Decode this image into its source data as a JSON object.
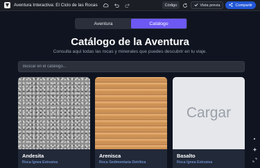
{
  "topbar": {
    "title": "Aventura Interactiva: El Ciclo de las Rocas",
    "code_label": "Código",
    "preview_label": "Vista previa",
    "share_label": "Compartir",
    "icons": [
      "app-logo",
      "cloud-icon",
      "undo-icon",
      "redo-icon",
      "refresh-icon",
      "check-icon",
      "share-icon"
    ]
  },
  "tabs": [
    {
      "label": "Aventura",
      "active": false
    },
    {
      "label": "Catálogo",
      "active": true
    }
  ],
  "main": {
    "title": "Catálogo de la Aventura",
    "subtitle": "Consulta aquí todas las rocas y minerales que puedes descubrir en tu viaje.",
    "search_placeholder": "Buscar en el catálogo..."
  },
  "cards": [
    {
      "name": "Andesita",
      "type": "Roca Ígnea Extrusiva"
    },
    {
      "name": "Arenisca",
      "type": "Roca Sedimentaria Detrítica"
    },
    {
      "name": "Basalto",
      "type": "Roca Ígnea Extrusiva",
      "placeholder_text": "Cargar"
    }
  ],
  "colors": {
    "background": "#0f1420",
    "accent": "#6d58f3",
    "share_button": "#2257d6",
    "card_type_text": "#8ab4ff"
  }
}
